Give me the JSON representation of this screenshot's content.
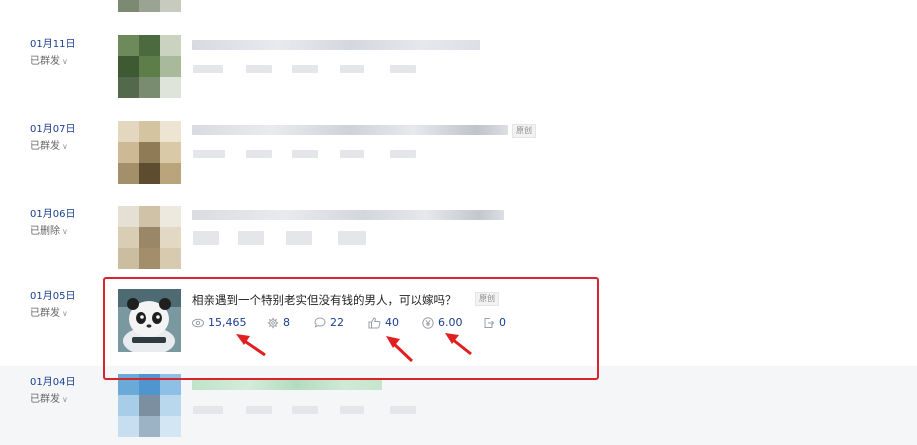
{
  "articles": [
    {
      "date": "01月11日",
      "status": "已群发"
    },
    {
      "date": "01月07日",
      "status": "已群发",
      "original_tag": "原创"
    },
    {
      "date": "01月06日",
      "status": "已删除"
    },
    {
      "date": "01月05日",
      "status": "已群发",
      "title": "相亲遇到一个特别老实但没有钱的男人，可以嫁吗？",
      "original_tag": "原创",
      "stats": {
        "reads": "15,465",
        "shares": "8",
        "comments": "22",
        "likes": "40",
        "appreciation": "6.00",
        "forwards": "0"
      }
    },
    {
      "date": "01月04日",
      "status": "已群发"
    }
  ],
  "colors": {
    "accent": "#1a3f8e",
    "highlight_box": "#d9242d",
    "arrow": "#e02020",
    "hover_row": "#f5f6f7"
  },
  "icons": [
    "eye-icon",
    "gear-icon",
    "comment-icon",
    "thumbs-up-icon",
    "yen-icon",
    "share-icon",
    "chevron-down-icon"
  ]
}
